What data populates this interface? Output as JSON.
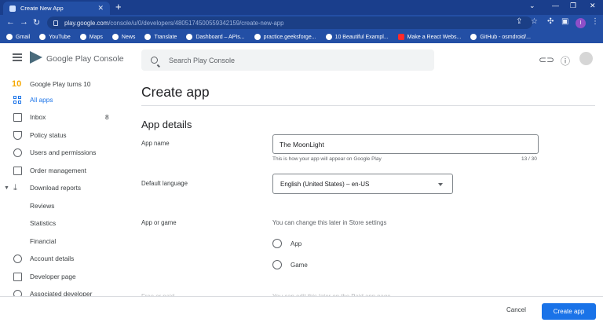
{
  "browser": {
    "tab_title": "Create New App",
    "url_host": "play.google.com",
    "url_path": "/console/u/0/developers/4805174500559342159/create-new-app",
    "profile_initial": "I",
    "bookmarks": [
      "Gmail",
      "YouTube",
      "Maps",
      "News",
      "Translate",
      "Dashboard – APIs...",
      "practice.geeksforge...",
      "10 Beautiful Exampl...",
      "Make a React Webs...",
      "GitHub - osmdroid/..."
    ]
  },
  "console": {
    "brand": "Google Play Console",
    "search_placeholder": "Search Play Console"
  },
  "sidebar": {
    "items": [
      {
        "label": "Google Play turns 10",
        "icon": "ten-icon"
      },
      {
        "label": "All apps",
        "icon": "grid-icon",
        "active": true
      },
      {
        "label": "Inbox",
        "count": "8",
        "icon": "inbox-icon"
      },
      {
        "label": "Policy status",
        "icon": "shield-icon"
      },
      {
        "label": "Users and permissions",
        "icon": "users-icon"
      },
      {
        "label": "Order management",
        "icon": "card-icon"
      },
      {
        "label": "Download reports",
        "icon": "download-icon"
      },
      {
        "label": "Reviews"
      },
      {
        "label": "Statistics"
      },
      {
        "label": "Financial"
      },
      {
        "label": "Account details",
        "icon": "account-icon"
      },
      {
        "label": "Developer page",
        "icon": "page-icon"
      },
      {
        "label": "Associated developer",
        "icon": "link-icon"
      }
    ]
  },
  "main": {
    "title": "Create app",
    "section": "App details",
    "app_name_label": "App name",
    "app_name_value": "The MoonLight",
    "app_name_hint": "This is how your app will appear on Google Play",
    "app_name_counter": "13 / 30",
    "language_label": "Default language",
    "language_value": "English (United States) – en-US",
    "app_or_game_label": "App or game",
    "app_or_game_help": "You can change this later in Store settings",
    "radio_app": "App",
    "radio_game": "Game",
    "free_paid_label": "Free or paid",
    "free_paid_help": "You can edit this later on the Paid app page"
  },
  "footer": {
    "cancel": "Cancel",
    "create": "Create app"
  }
}
